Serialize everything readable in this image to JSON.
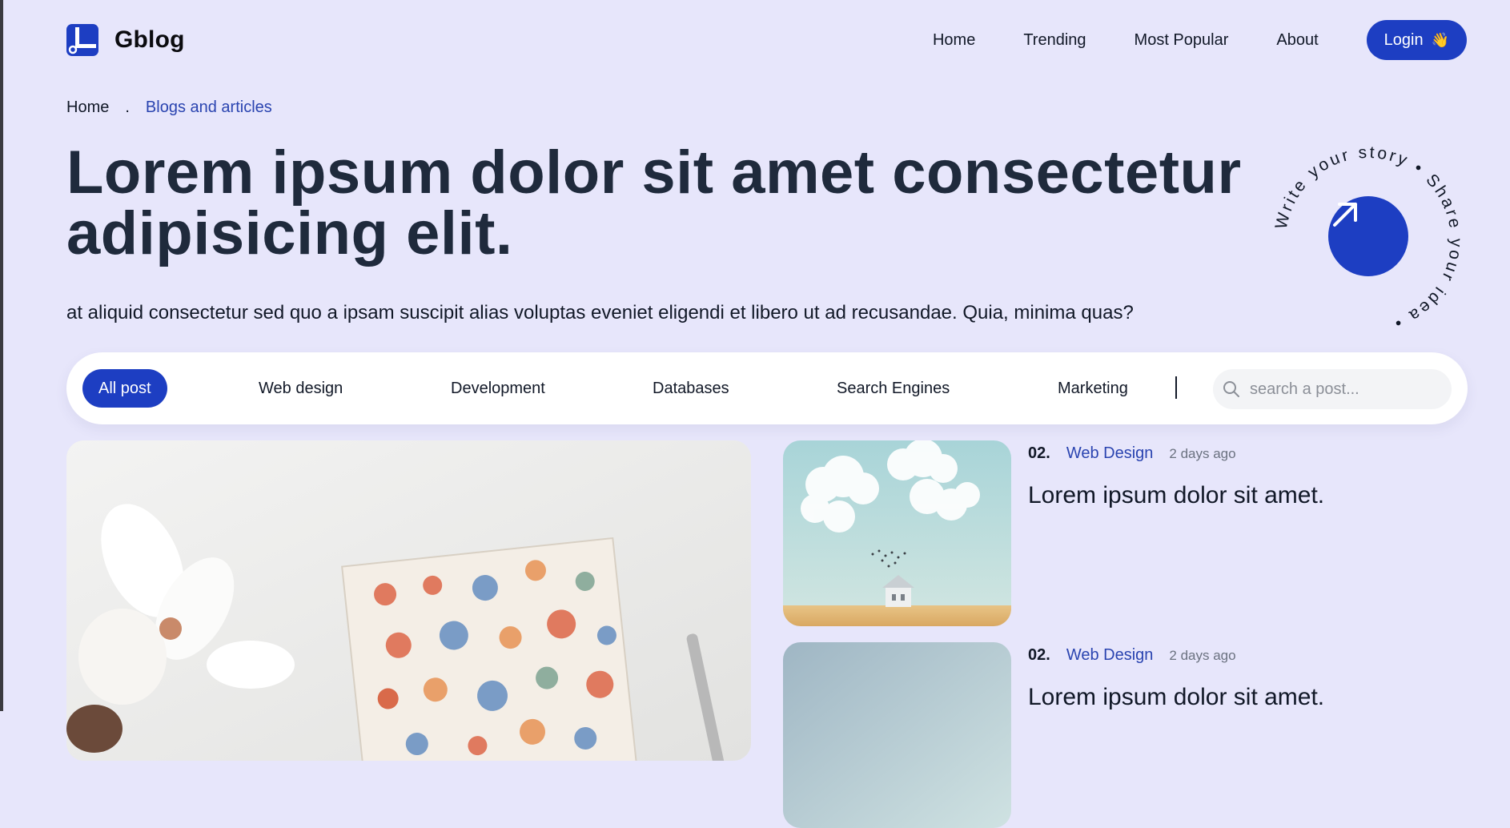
{
  "brand": {
    "name": "Gblog"
  },
  "nav": {
    "links": [
      "Home",
      "Trending",
      "Most Popular",
      "About"
    ],
    "login_label": "Login",
    "login_emoji": "👋"
  },
  "breadcrumb": {
    "home": "Home",
    "separator": ".",
    "current": "Blogs and articles"
  },
  "hero": {
    "title": "Lorem ipsum dolor sit amet consectetur adipisicing elit.",
    "subtitle": "at aliquid consectetur sed quo a ipsam suscipit alias voluptas eveniet eligendi et libero ut ad recusandae. Quia, minima quas?"
  },
  "cta": {
    "ring_text": "Write your story • Share your idea •"
  },
  "filters": {
    "categories": [
      "All post",
      "Web design",
      "Development",
      "Databases",
      "Search Engines",
      "Marketing"
    ],
    "active": "All post",
    "search_placeholder": "search a post..."
  },
  "posts": [
    {
      "number": "02.",
      "category": "Web Design",
      "time": "2 days ago",
      "title": "Lorem ipsum dolor sit amet."
    },
    {
      "number": "02.",
      "category": "Web Design",
      "time": "2 days ago",
      "title": "Lorem ipsum dolor sit amet."
    }
  ],
  "colors": {
    "background": "#e7e6fb",
    "accent": "#1d3ec2",
    "heading": "#1f2a3c",
    "link": "#2a44b0"
  }
}
